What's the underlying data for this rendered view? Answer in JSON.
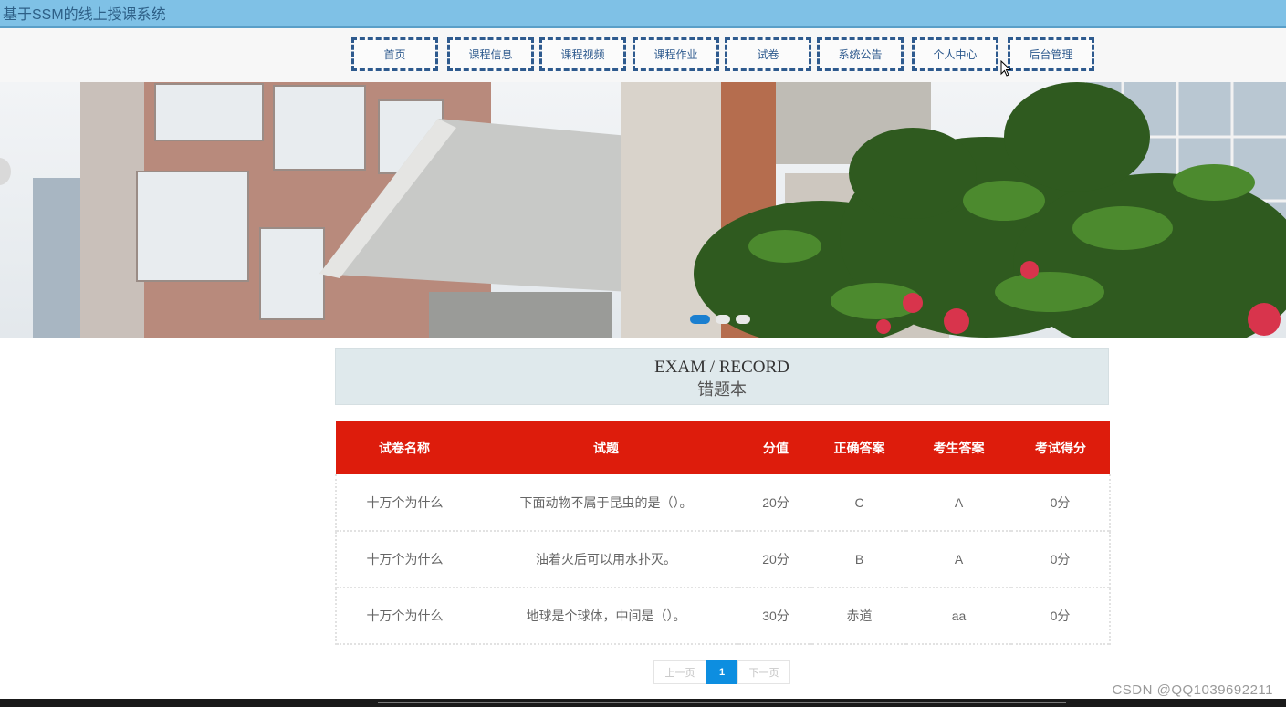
{
  "header": {
    "site_title": "基于SSM的线上授课系统"
  },
  "nav": {
    "items": [
      {
        "label": "首页"
      },
      {
        "label": "课程信息"
      },
      {
        "label": "课程视频"
      },
      {
        "label": "课程作业"
      },
      {
        "label": "试卷"
      },
      {
        "label": "系统公告"
      },
      {
        "label": "个人中心"
      },
      {
        "label": "后台管理"
      }
    ]
  },
  "banner": {
    "slides": 3,
    "active_slide": 1
  },
  "section": {
    "title_en": "EXAM / RECORD",
    "title_cn": "错题本"
  },
  "table": {
    "columns": [
      "试卷名称",
      "试题",
      "分值",
      "正确答案",
      "考生答案",
      "考试得分"
    ],
    "rows": [
      [
        "十万个为什么",
        "下面动物不属于昆虫的是（）。",
        "20分",
        "C",
        "A",
        "0分"
      ],
      [
        "十万个为什么",
        "油着火后可以用水扑灭。",
        "20分",
        "B",
        "A",
        "0分"
      ],
      [
        "十万个为什么",
        "地球是个球体，中间是（）。",
        "30分",
        "赤道",
        "aa",
        "0分"
      ]
    ]
  },
  "pagination": {
    "prev": "上一页",
    "current": "1",
    "next": "下一页"
  },
  "watermark": "CSDN @QQ1039692211",
  "colors": {
    "topbar": "#7fc1e6",
    "nav_border": "#2e5a8e",
    "table_header": "#dd1c0c",
    "pager_active": "#0d8ee0"
  }
}
